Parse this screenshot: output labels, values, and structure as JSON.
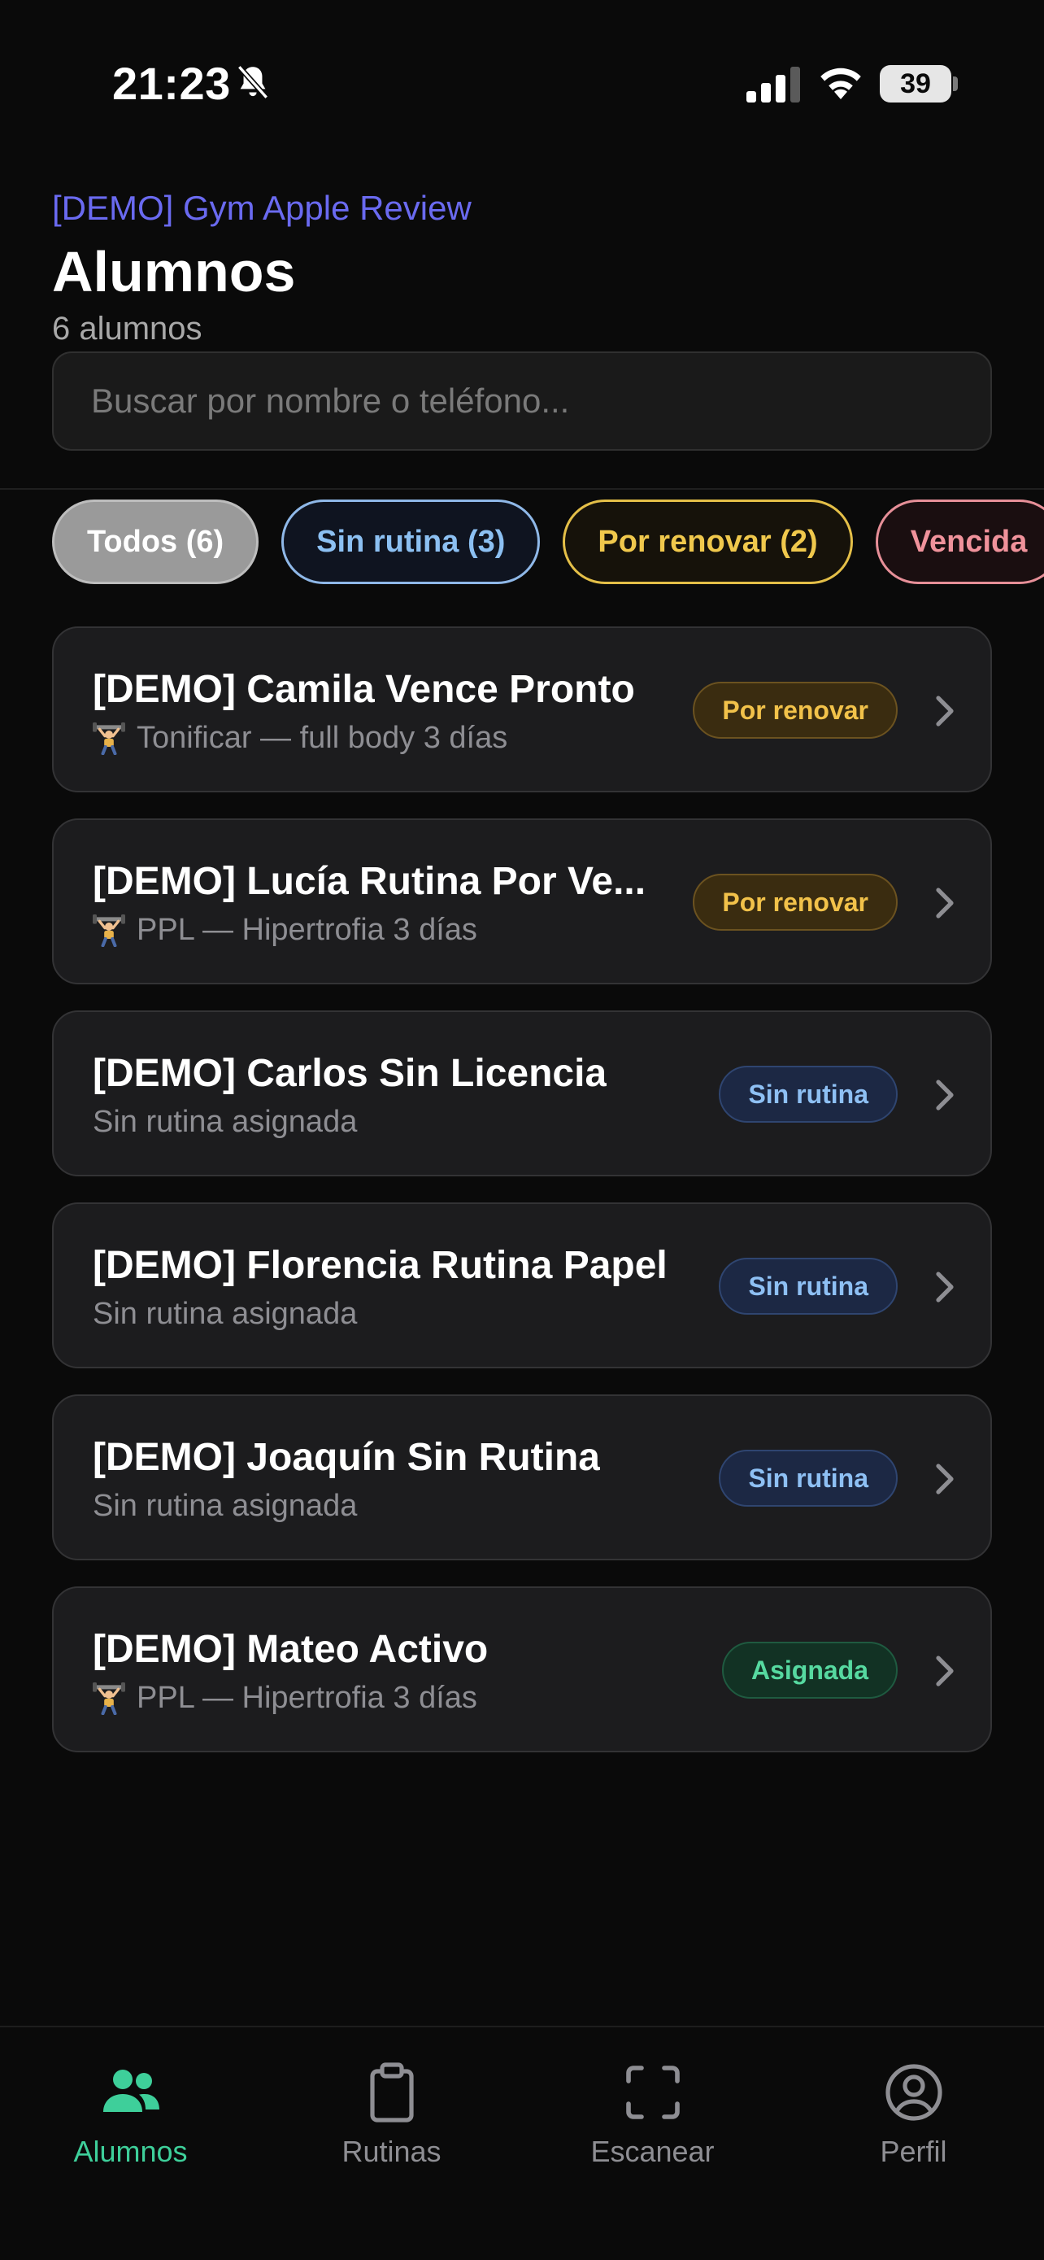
{
  "status_bar": {
    "time": "21:23",
    "battery": "39"
  },
  "header": {
    "gym_name": "[DEMO] Gym Apple Review",
    "title": "Alumnos",
    "count": "6 alumnos"
  },
  "search": {
    "placeholder": "Buscar por nombre o teléfono..."
  },
  "filters": [
    {
      "label": "Todos (6)",
      "selected": true
    },
    {
      "label": "Sin rutina (3)",
      "selected": false
    },
    {
      "label": "Por renovar (2)",
      "selected": false
    },
    {
      "label": "Vencida",
      "selected": false
    }
  ],
  "students": [
    {
      "name": "[DEMO] Camila Vence Pronto",
      "routine": "Tonificar — full body 3 días",
      "has_routine": true,
      "badge": "Por renovar",
      "status": "renew"
    },
    {
      "name": "[DEMO] Lucía Rutina Por Ve...",
      "routine": "PPL — Hipertrofia 3 días",
      "has_routine": true,
      "badge": "Por renovar",
      "status": "renew"
    },
    {
      "name": "[DEMO] Carlos Sin Licencia",
      "routine": "Sin rutina asignada",
      "has_routine": false,
      "badge": "Sin rutina",
      "status": "noroutine"
    },
    {
      "name": "[DEMO] Florencia Rutina Papel",
      "routine": "Sin rutina asignada",
      "has_routine": false,
      "badge": "Sin rutina",
      "status": "noroutine"
    },
    {
      "name": "[DEMO] Joaquín Sin Rutina",
      "routine": "Sin rutina asignada",
      "has_routine": false,
      "badge": "Sin rutina",
      "status": "noroutine"
    },
    {
      "name": "[DEMO] Mateo Activo",
      "routine": "PPL — Hipertrofia 3 días",
      "has_routine": true,
      "badge": "Asignada",
      "status": "assigned"
    }
  ],
  "tabs": [
    {
      "label": "Alumnos",
      "icon": "users-icon",
      "active": true
    },
    {
      "label": "Rutinas",
      "icon": "clipboard-icon",
      "active": false
    },
    {
      "label": "Escanear",
      "icon": "scan-icon",
      "active": false
    },
    {
      "label": "Perfil",
      "icon": "profile-icon",
      "active": false
    }
  ],
  "colors": {
    "accent": "#3ecf9a",
    "gym_name": "#6a6af0",
    "renew": "#f2c24a",
    "noroutine": "#8ec0f4",
    "expired": "#f0929b"
  }
}
